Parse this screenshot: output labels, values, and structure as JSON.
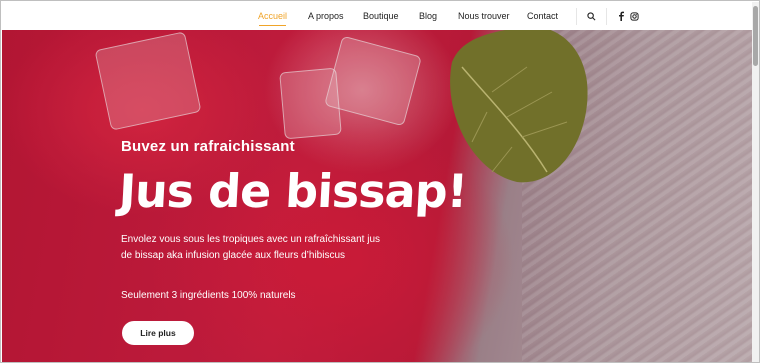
{
  "nav": {
    "items": [
      {
        "label": "Accueil",
        "active": true
      },
      {
        "label": "A propos",
        "active": false
      },
      {
        "label": "Boutique",
        "active": false
      },
      {
        "label": "Blog",
        "active": false
      },
      {
        "label": "Nous trouver",
        "active": false
      },
      {
        "label": "Contact",
        "active": false
      }
    ],
    "icons": [
      "search-icon",
      "facebook-icon",
      "instagram-icon"
    ],
    "accent_color": "#f0a429"
  },
  "hero": {
    "subtitle": "Buvez un rafraichissant",
    "title": "Jus de bissap!",
    "description": "Envolez vous sous les tropiques avec un rafraîchissant jus de bissap aka infusion glacée aux fleurs d’hibiscus",
    "claim": "Seulement 3 ingrédients 100% naturels",
    "cta_label": "Lire plus"
  }
}
